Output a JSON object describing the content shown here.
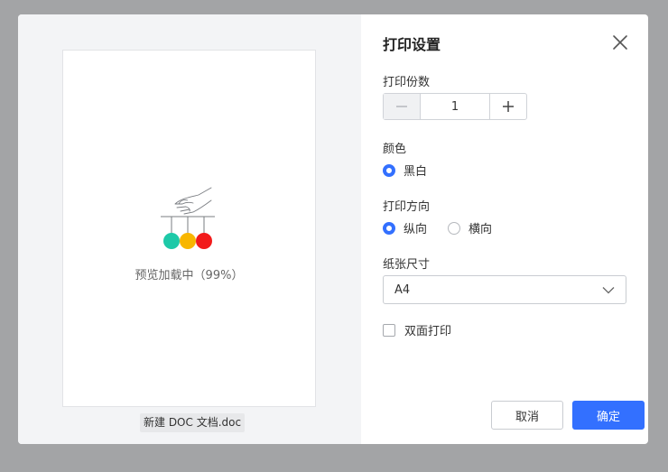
{
  "preview": {
    "loading_text": "预览加载中（99%）",
    "loading_progress": 0.99,
    "file_name": "新建 DOC 文档.doc",
    "loader_colors": [
      "#1ec9a8",
      "#f8b600",
      "#f21b1b"
    ]
  },
  "settings": {
    "title": "打印设置",
    "copies": {
      "label": "打印份数",
      "value": "1"
    },
    "color": {
      "label": "颜色",
      "options": [
        {
          "label": "黑白",
          "checked": true
        }
      ]
    },
    "orientation": {
      "label": "打印方向",
      "options": [
        {
          "label": "纵向",
          "checked": true
        },
        {
          "label": "横向",
          "checked": false
        }
      ]
    },
    "paper": {
      "label": "纸张尺寸",
      "selected": "A4"
    },
    "duplex": {
      "label": "双面打印",
      "checked": false
    },
    "buttons": {
      "cancel": "取消",
      "ok": "确定"
    }
  },
  "colors": {
    "accent": "#3370ff",
    "overlay": "#a3a4a6",
    "preview_bg": "#f3f4f6"
  },
  "icons": {
    "close": "close-icon",
    "minus": "minus-icon",
    "plus": "plus-icon",
    "dropdown": "chevron-down-icon"
  }
}
